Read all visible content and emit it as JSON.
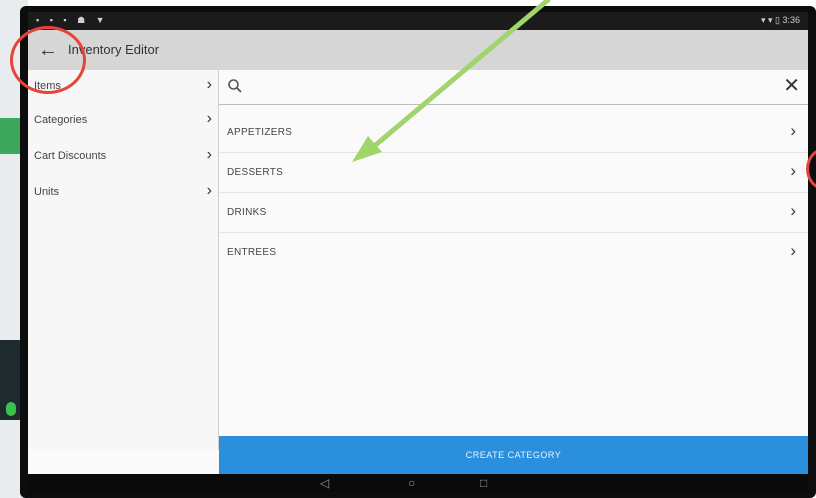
{
  "status_bar": {
    "left_icons": "▪ ▪ ▪ ☗ ▼",
    "right_text": "▾ ▾ ▯ 3:36"
  },
  "app_bar": {
    "title": "Inventory Editor"
  },
  "left_nav": {
    "items": [
      {
        "label": "Items"
      },
      {
        "label": "Categories"
      },
      {
        "label": "Cart Discounts"
      },
      {
        "label": "Units"
      }
    ]
  },
  "search": {
    "placeholder": "",
    "value": ""
  },
  "categories": [
    {
      "label": "APPETIZERS"
    },
    {
      "label": "DESSERTS"
    },
    {
      "label": "DRINKS"
    },
    {
      "label": "ENTREES"
    }
  ],
  "create_button": {
    "label": "CREATE CATEGORY"
  },
  "colors": {
    "accent": "#2a8fdc",
    "annotation_circle": "#e8433a",
    "annotation_arrow": "#9fd56b"
  },
  "icons": {
    "back": "back-arrow-icon",
    "search": "search-icon",
    "clear": "close-icon",
    "chevron": "chevron-right-icon"
  }
}
